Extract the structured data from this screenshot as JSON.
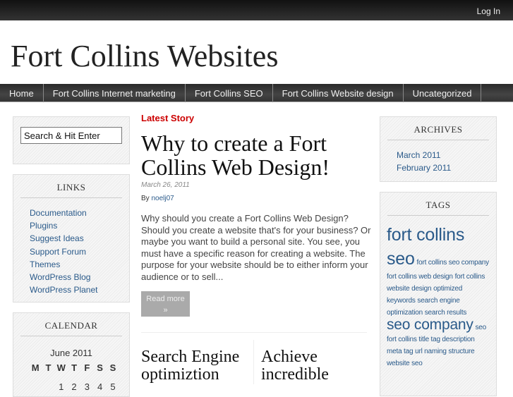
{
  "topbar": {
    "login": "Log In"
  },
  "site": {
    "title": "Fort Collins Websites"
  },
  "nav": [
    "Home",
    "Fort Collins Internet marketing",
    "Fort Collins SEO",
    "Fort Collins Website design",
    "Uncategorized"
  ],
  "search": {
    "placeholder": "Search & Hit Enter"
  },
  "links": {
    "title": "LINKS",
    "items": [
      "Documentation",
      "Plugins",
      "Suggest Ideas",
      "Support Forum",
      "Themes",
      "WordPress Blog",
      "WordPress Planet"
    ]
  },
  "calendar": {
    "title": "CALENDAR",
    "month": "June 2011",
    "days": [
      "M",
      "T",
      "W",
      "T",
      "F",
      "S",
      "S"
    ],
    "row1": [
      "",
      "",
      "1",
      "2",
      "3",
      "4",
      "5"
    ]
  },
  "main": {
    "latest": "Latest Story",
    "post_title": "Why to create a Fort Collins Web Design!",
    "date": "March 26, 2011",
    "by": "By",
    "author": "noelj07",
    "excerpt": "Why should  you create a Fort Collins Web Design? Should you create a website that's for your business? Or  maybe you want to build a personal site. You see, you must have a specific reason for creating a website. The purpose for your website should be to either inform your audience or to sell...",
    "read_more": "Read more",
    "read_more_arrow": "»",
    "sub1": "Search Engine optimiztion",
    "sub2": "Achieve incredible"
  },
  "archives": {
    "title": "ARCHIVES",
    "items": [
      "March 2011",
      "February 2011"
    ]
  },
  "tags": {
    "title": "TAGS",
    "items": [
      {
        "label": "fort collins seo",
        "size": "t1"
      },
      {
        "label": "fort collins seo company",
        "size": ""
      },
      {
        "label": "fort collins web design",
        "size": ""
      },
      {
        "label": "fort collins website design",
        "size": ""
      },
      {
        "label": "optimized keywords",
        "size": ""
      },
      {
        "label": "search engine optimization",
        "size": ""
      },
      {
        "label": "search results",
        "size": ""
      },
      {
        "label": "seo company",
        "size": "t2"
      },
      {
        "label": "seo fort collins",
        "size": ""
      },
      {
        "label": "title tag description",
        "size": ""
      },
      {
        "label": "meta tag",
        "size": ""
      },
      {
        "label": "url naming structure",
        "size": ""
      },
      {
        "label": "website seo",
        "size": ""
      }
    ]
  }
}
